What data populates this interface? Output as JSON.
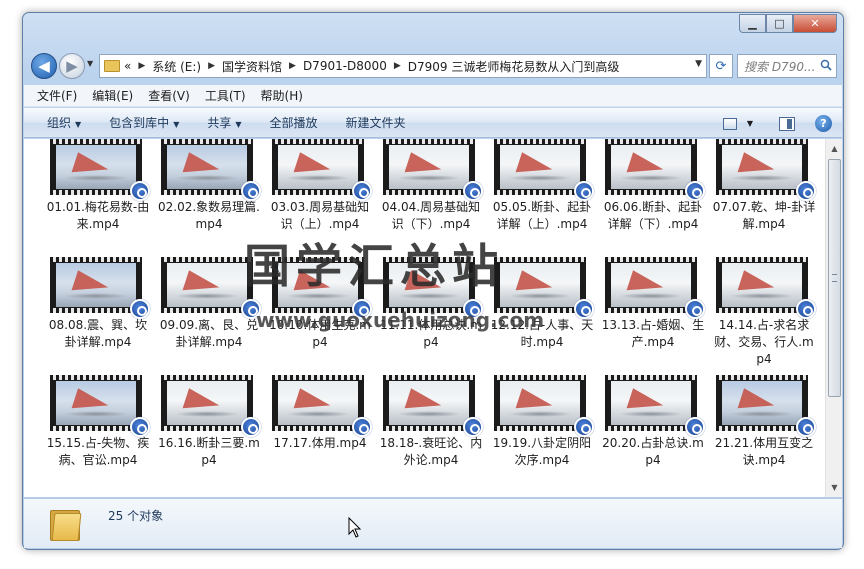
{
  "window": {
    "controls": {
      "minimize": "▁",
      "maximize": "□",
      "close": "✕"
    }
  },
  "nav": {
    "back_glyph": "◀",
    "forward_glyph": "▶",
    "history_glyph": "▼",
    "breadcrumb_prefix": "«",
    "breadcrumb": [
      "系统 (E:)",
      "国学资料馆",
      "D7901-D8000",
      "D7909 三诚老师梅花易数从入门到高级"
    ],
    "crumb_separator": "▶",
    "refresh_glyph": "⟳",
    "search_placeholder": "搜索 D790..."
  },
  "menu": [
    "文件(F)",
    "编辑(E)",
    "查看(V)",
    "工具(T)",
    "帮助(H)"
  ],
  "toolbar": {
    "organize": "组织",
    "include_in_library": "包含到库中",
    "share": "共享",
    "play_all": "全部播放",
    "new_folder": "新建文件夹",
    "dropdown_glyph": "▼",
    "help_glyph": "?"
  },
  "files": [
    {
      "name": "01.01.梅花易数-由来.mp4",
      "thumb": "blue"
    },
    {
      "name": "02.02.象数易理篇.mp4",
      "thumb": "blue"
    },
    {
      "name": "03.03.周易基础知识（上）.mp4",
      "thumb": "light"
    },
    {
      "name": "04.04.周易基础知识（下）.mp4",
      "thumb": "light"
    },
    {
      "name": "05.05.断卦、起卦详解（上）.mp4",
      "thumb": "light"
    },
    {
      "name": "06.06.断卦、起卦详解（下）.mp4",
      "thumb": "light"
    },
    {
      "name": "07.07.乾、坤-卦详解.mp4",
      "thumb": "light"
    },
    {
      "name": "08.08.震、巽、坎卦详解.mp4",
      "thumb": "blue"
    },
    {
      "name": "09.09.离、艮、兑卦详解.mp4",
      "thumb": "light"
    },
    {
      "name": "10.10.体用生克.mp4",
      "thumb": "light"
    },
    {
      "name": "11.11.体用总诀.mp4",
      "thumb": "light"
    },
    {
      "name": "12.12.占-人事、天时.mp4",
      "thumb": "light"
    },
    {
      "name": "13.13.占-婚姻、生产.mp4",
      "thumb": "light"
    },
    {
      "name": "14.14.占-求名求财、交易、行人.mp4",
      "thumb": "light"
    },
    {
      "name": "15.15.占-失物、疾病、官讼.mp4",
      "thumb": "blue"
    },
    {
      "name": "16.16.断卦三要.mp4",
      "thumb": "light"
    },
    {
      "name": "17.17.体用.mp4",
      "thumb": "light"
    },
    {
      "name": "18.18-.衰旺论、内外论.mp4",
      "thumb": "light"
    },
    {
      "name": "19.19.八卦定阴阳次序.mp4",
      "thumb": "light"
    },
    {
      "name": "20.20.占卦总诀.mp4",
      "thumb": "light"
    },
    {
      "name": "21.21.体用互变之诀.mp4",
      "thumb": "blue"
    }
  ],
  "details": {
    "count_text": "25 个对象"
  },
  "watermark": {
    "title": "国学汇总站",
    "url": "www.guoxuehuizong.com"
  },
  "scrollbar": {
    "up_glyph": "▲",
    "down_glyph": "▼"
  }
}
